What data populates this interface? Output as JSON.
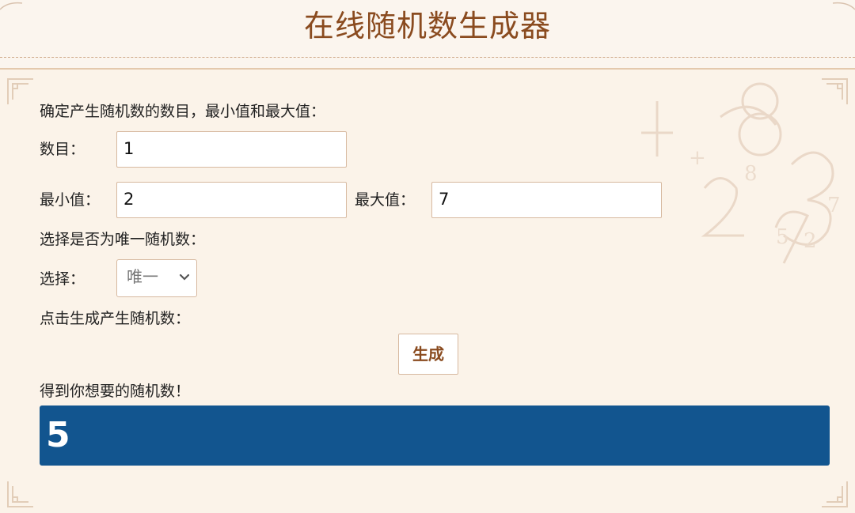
{
  "header": {
    "title": "在线随机数生成器"
  },
  "form": {
    "intro": "确定产生随机数的数目，最小值和最大值：",
    "count_label": "数目：",
    "count_value": "1",
    "min_label": "最小值：",
    "min_value": "2",
    "max_label": "最大值：",
    "max_value": "7",
    "unique_prompt": "选择是否为唯一随机数：",
    "select_label": "选择：",
    "select_value": "唯一",
    "generate_prompt": "点击生成产生随机数：",
    "generate_button": "生成",
    "result_prompt": "得到你想要的随机数！",
    "result_value": "5"
  },
  "colors": {
    "accent": "#8a4b1f",
    "result_bg": "#12558f",
    "page_bg": "#fbf3e9"
  }
}
